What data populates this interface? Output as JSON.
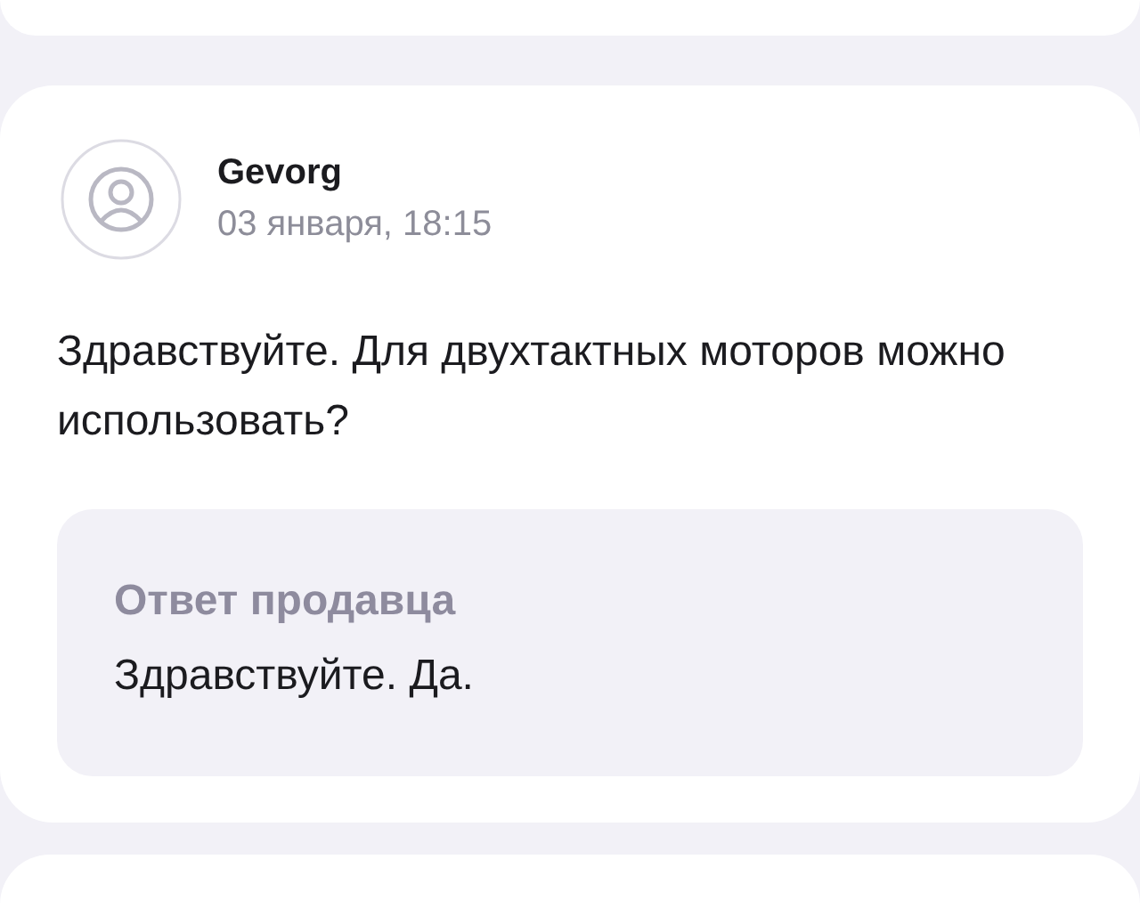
{
  "review": {
    "author": "Gevorg",
    "date": "03 января, 18:15",
    "text": "Здравствуйте. Для двухтактных моторов можно использовать?",
    "answer": {
      "label": "Ответ продавца",
      "text": "Здравствуйте. Да."
    }
  }
}
